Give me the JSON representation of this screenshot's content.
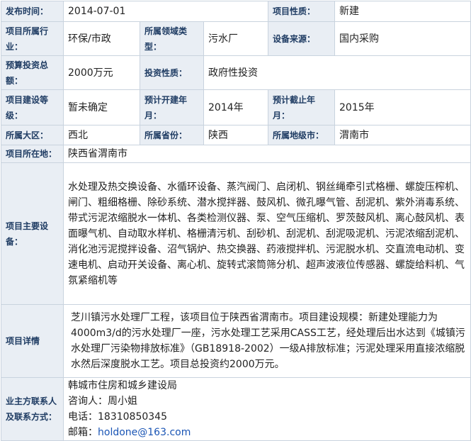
{
  "rows": {
    "publish_date": {
      "label": "发布时间：",
      "value": "2014-07-01"
    },
    "project_nature": {
      "label": "项目性质：",
      "value": "新建"
    },
    "industry": {
      "label": "项目所属行业：",
      "value": "环保/市政"
    },
    "field_type": {
      "label": "所属领域类型：",
      "value": "污水厂"
    },
    "equipment_source": {
      "label": "设备来源：",
      "value": "国内采购"
    },
    "budget": {
      "label": "预算投资总额：",
      "value": "2000万元"
    },
    "investment_nature": {
      "label": "投资性质：",
      "value": "政府性投资"
    },
    "construction_level": {
      "label": "项目建设等级：",
      "value": "暂未确定"
    },
    "start_year": {
      "label": "预计开建年月：",
      "value": "2014年"
    },
    "end_year": {
      "label": "预计截止年月：",
      "value": "2015年"
    },
    "region": {
      "label": "所属大区：",
      "value": "西北"
    },
    "province": {
      "label": "所属省份：",
      "value": "陕西"
    },
    "city": {
      "label": "所属地级市：",
      "value": "渭南市"
    },
    "location": {
      "label": "项目所在地：",
      "value": "陕西省渭南市"
    },
    "main_equipment": {
      "label": "项目主要设备：",
      "value": "水处理及热交换设备、水循环设备、蒸汽阀门、启闭机、钢丝绳牵引式格栅、螺旋压榨机、闸门、粗细格栅、除砂系统、潜水搅拌器、鼓风机、微孔曝气管、刮泥机、紫外消毒系统、带式污泥浓缩脱水一体机、各类检测仪器、泵、空气压缩机、罗茨鼓风机、离心鼓风机、表面曝气机、自动取水样机、格栅清污机、刮砂机、刮泥机、刮泥吸泥机、污泥浓缩刮泥机、消化池污泥搅拌设备、沼气锅炉、热交换器、药液搅拌机、污泥脱水机、交直流电动机、变速电机、启动开关设备、离心机、旋转式滚筒筛分机、超声波液位传感器、螺旋给料机、气氛紧缩机等"
    },
    "details": {
      "label": "项目详情",
      "value": "芝川镇污水处理厂工程，该项目位于陕西省渭南市。项目建设规模：新建处理能力为4000m3/d的污水处理厂一座，污水处理工艺采用CASS工艺，经处理后出水达到《城镇污水处理厂污染物排放标准》（GB18918-2002）一级A排放标准；污泥处理采用直接浓缩脱水然后深度脱水工艺。项目总投资约2000万元。"
    },
    "owner": {
      "label": "业主方联系人及联系方式：",
      "org": "韩城市住房和城乡建设局",
      "consultant": "咨询人：周小姐",
      "phone": "电话：18310850345",
      "email_label": "邮箱：",
      "email": "holdone@163.com"
    }
  }
}
